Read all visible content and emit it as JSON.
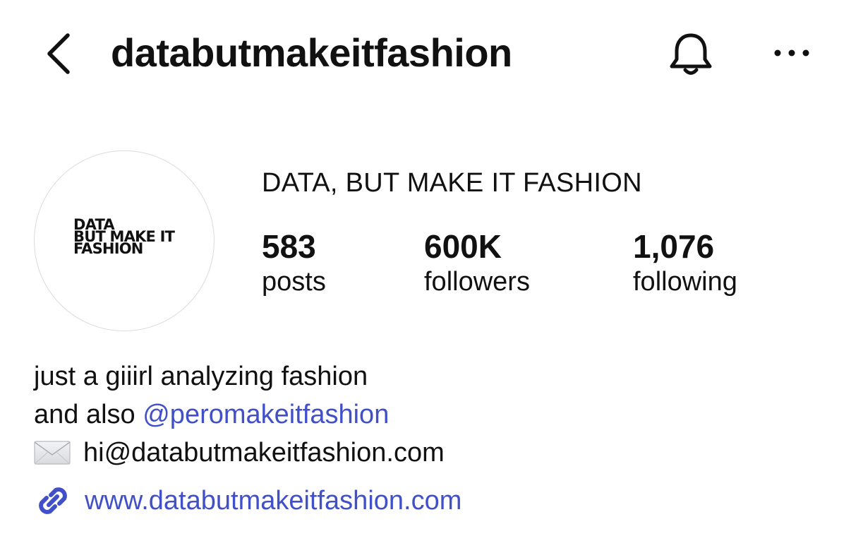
{
  "header": {
    "username": "databutmakeitfashion",
    "back_icon": "chevron-left-icon",
    "bell_icon": "bell-icon",
    "more_icon": "more-horizontal-icon"
  },
  "profile": {
    "avatar_lines": [
      "DATA",
      "BUT MAKE IT",
      "FASHION"
    ],
    "display_name": "DATA, BUT MAKE IT FASHION",
    "stats": {
      "posts": {
        "value": "583",
        "label": "posts"
      },
      "followers": {
        "value": "600K",
        "label": "followers"
      },
      "following": {
        "value": "1,076",
        "label": "following"
      }
    }
  },
  "bio": {
    "line1": "just a giiirl analyzing fashion",
    "line2_prefix": "and also ",
    "line2_mention": "@peromakeitfashion",
    "email": "hi@databutmakeitfashion.com",
    "email_icon": "envelope-icon"
  },
  "website": {
    "url": "www.databutmakeitfashion.com",
    "icon": "link-icon"
  },
  "colors": {
    "text": "#111111",
    "link": "#4150c8",
    "avatar_border": "#dbdbdb"
  }
}
